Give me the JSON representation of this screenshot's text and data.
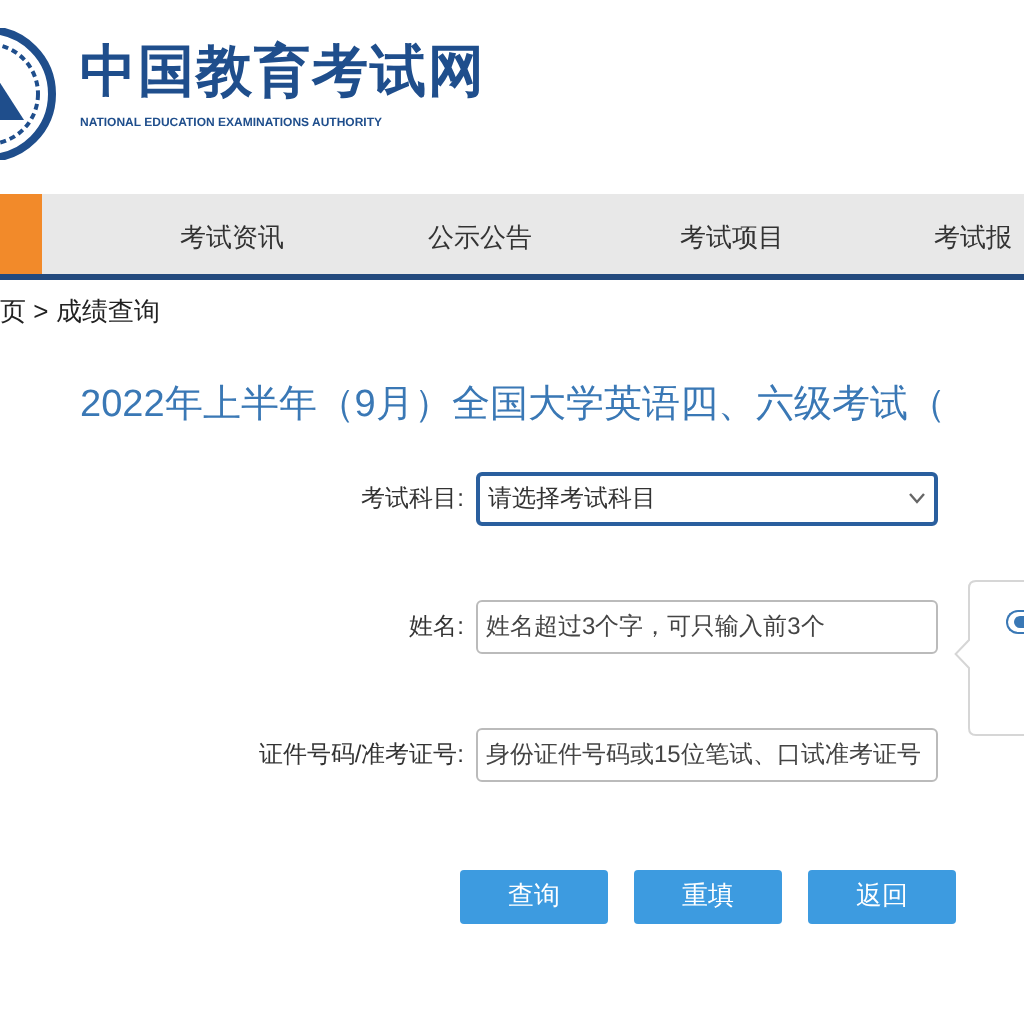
{
  "header": {
    "title": "中国教育考试网",
    "subtitle": "NATIONAL EDUCATION EXAMINATIONS AUTHORITY"
  },
  "nav": [
    {
      "label": "考试资讯"
    },
    {
      "label": "公示公告"
    },
    {
      "label": "考试项目"
    },
    {
      "label": "考试报"
    }
  ],
  "breadcrumb": "页 > 成绩查询",
  "page_title": "2022年上半年（9月）全国大学英语四、六级考试（",
  "form": [
    {
      "kind": "select",
      "label": "考试科目:",
      "placeholder": "请选择考试科目",
      "focused": true
    },
    {
      "kind": "input",
      "label": "姓名:",
      "placeholder": "姓名超过3个字，可只输入前3个",
      "focused": false
    },
    {
      "kind": "input",
      "label": "证件号码/准考证号:",
      "placeholder": "身份证件号码或15位笔试、口试准考证号",
      "focused": false
    }
  ],
  "buttons": [
    "查询",
    "重填",
    "返回"
  ],
  "popover": {
    "checked": true
  }
}
